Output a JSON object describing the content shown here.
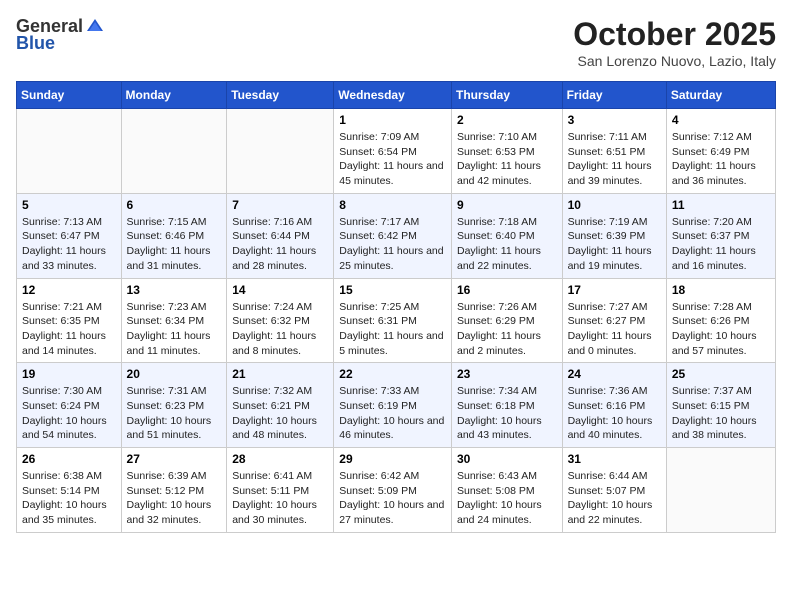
{
  "header": {
    "logo": {
      "general": "General",
      "blue": "Blue"
    },
    "title": "October 2025",
    "location": "San Lorenzo Nuovo, Lazio, Italy"
  },
  "weekdays": [
    "Sunday",
    "Monday",
    "Tuesday",
    "Wednesday",
    "Thursday",
    "Friday",
    "Saturday"
  ],
  "weeks": [
    [
      {
        "day": "",
        "info": ""
      },
      {
        "day": "",
        "info": ""
      },
      {
        "day": "",
        "info": ""
      },
      {
        "day": "1",
        "info": "Sunrise: 7:09 AM\nSunset: 6:54 PM\nDaylight: 11 hours and 45 minutes."
      },
      {
        "day": "2",
        "info": "Sunrise: 7:10 AM\nSunset: 6:53 PM\nDaylight: 11 hours and 42 minutes."
      },
      {
        "day": "3",
        "info": "Sunrise: 7:11 AM\nSunset: 6:51 PM\nDaylight: 11 hours and 39 minutes."
      },
      {
        "day": "4",
        "info": "Sunrise: 7:12 AM\nSunset: 6:49 PM\nDaylight: 11 hours and 36 minutes."
      }
    ],
    [
      {
        "day": "5",
        "info": "Sunrise: 7:13 AM\nSunset: 6:47 PM\nDaylight: 11 hours and 33 minutes."
      },
      {
        "day": "6",
        "info": "Sunrise: 7:15 AM\nSunset: 6:46 PM\nDaylight: 11 hours and 31 minutes."
      },
      {
        "day": "7",
        "info": "Sunrise: 7:16 AM\nSunset: 6:44 PM\nDaylight: 11 hours and 28 minutes."
      },
      {
        "day": "8",
        "info": "Sunrise: 7:17 AM\nSunset: 6:42 PM\nDaylight: 11 hours and 25 minutes."
      },
      {
        "day": "9",
        "info": "Sunrise: 7:18 AM\nSunset: 6:40 PM\nDaylight: 11 hours and 22 minutes."
      },
      {
        "day": "10",
        "info": "Sunrise: 7:19 AM\nSunset: 6:39 PM\nDaylight: 11 hours and 19 minutes."
      },
      {
        "day": "11",
        "info": "Sunrise: 7:20 AM\nSunset: 6:37 PM\nDaylight: 11 hours and 16 minutes."
      }
    ],
    [
      {
        "day": "12",
        "info": "Sunrise: 7:21 AM\nSunset: 6:35 PM\nDaylight: 11 hours and 14 minutes."
      },
      {
        "day": "13",
        "info": "Sunrise: 7:23 AM\nSunset: 6:34 PM\nDaylight: 11 hours and 11 minutes."
      },
      {
        "day": "14",
        "info": "Sunrise: 7:24 AM\nSunset: 6:32 PM\nDaylight: 11 hours and 8 minutes."
      },
      {
        "day": "15",
        "info": "Sunrise: 7:25 AM\nSunset: 6:31 PM\nDaylight: 11 hours and 5 minutes."
      },
      {
        "day": "16",
        "info": "Sunrise: 7:26 AM\nSunset: 6:29 PM\nDaylight: 11 hours and 2 minutes."
      },
      {
        "day": "17",
        "info": "Sunrise: 7:27 AM\nSunset: 6:27 PM\nDaylight: 11 hours and 0 minutes."
      },
      {
        "day": "18",
        "info": "Sunrise: 7:28 AM\nSunset: 6:26 PM\nDaylight: 10 hours and 57 minutes."
      }
    ],
    [
      {
        "day": "19",
        "info": "Sunrise: 7:30 AM\nSunset: 6:24 PM\nDaylight: 10 hours and 54 minutes."
      },
      {
        "day": "20",
        "info": "Sunrise: 7:31 AM\nSunset: 6:23 PM\nDaylight: 10 hours and 51 minutes."
      },
      {
        "day": "21",
        "info": "Sunrise: 7:32 AM\nSunset: 6:21 PM\nDaylight: 10 hours and 48 minutes."
      },
      {
        "day": "22",
        "info": "Sunrise: 7:33 AM\nSunset: 6:19 PM\nDaylight: 10 hours and 46 minutes."
      },
      {
        "day": "23",
        "info": "Sunrise: 7:34 AM\nSunset: 6:18 PM\nDaylight: 10 hours and 43 minutes."
      },
      {
        "day": "24",
        "info": "Sunrise: 7:36 AM\nSunset: 6:16 PM\nDaylight: 10 hours and 40 minutes."
      },
      {
        "day": "25",
        "info": "Sunrise: 7:37 AM\nSunset: 6:15 PM\nDaylight: 10 hours and 38 minutes."
      }
    ],
    [
      {
        "day": "26",
        "info": "Sunrise: 6:38 AM\nSunset: 5:14 PM\nDaylight: 10 hours and 35 minutes."
      },
      {
        "day": "27",
        "info": "Sunrise: 6:39 AM\nSunset: 5:12 PM\nDaylight: 10 hours and 32 minutes."
      },
      {
        "day": "28",
        "info": "Sunrise: 6:41 AM\nSunset: 5:11 PM\nDaylight: 10 hours and 30 minutes."
      },
      {
        "day": "29",
        "info": "Sunrise: 6:42 AM\nSunset: 5:09 PM\nDaylight: 10 hours and 27 minutes."
      },
      {
        "day": "30",
        "info": "Sunrise: 6:43 AM\nSunset: 5:08 PM\nDaylight: 10 hours and 24 minutes."
      },
      {
        "day": "31",
        "info": "Sunrise: 6:44 AM\nSunset: 5:07 PM\nDaylight: 10 hours and 22 minutes."
      },
      {
        "day": "",
        "info": ""
      }
    ]
  ]
}
